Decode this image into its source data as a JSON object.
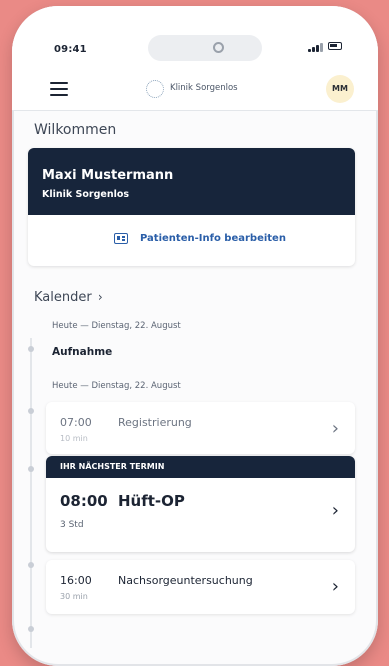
{
  "status": {
    "time": "09:41"
  },
  "header": {
    "clinic_logo_text": "Klinik Sorgenlos",
    "avatar_initials": "MM"
  },
  "welcome": "Wilkommen",
  "patient": {
    "name": "Maxi Mustermann",
    "clinic": "Klinik Sorgenlos",
    "edit_label": "Patienten-Info bearbeiten"
  },
  "calendar": {
    "title": "Kalender",
    "days": [
      {
        "label": "Heute — Dienstag, 22. August",
        "event": "Aufnahme"
      },
      {
        "label": "Heute — Dienstag, 22. August"
      }
    ],
    "appointments": [
      {
        "time": "07:00",
        "name": "Registrierung",
        "duration": "10 min"
      },
      {
        "time": "08:00",
        "name": "Hüft-OP",
        "duration": "3 Std",
        "badge": "IHR NÄCHSTER TERMIN"
      },
      {
        "time": "16:00",
        "name": "Nachsorgeuntersuchung",
        "duration": "30 min"
      }
    ]
  }
}
